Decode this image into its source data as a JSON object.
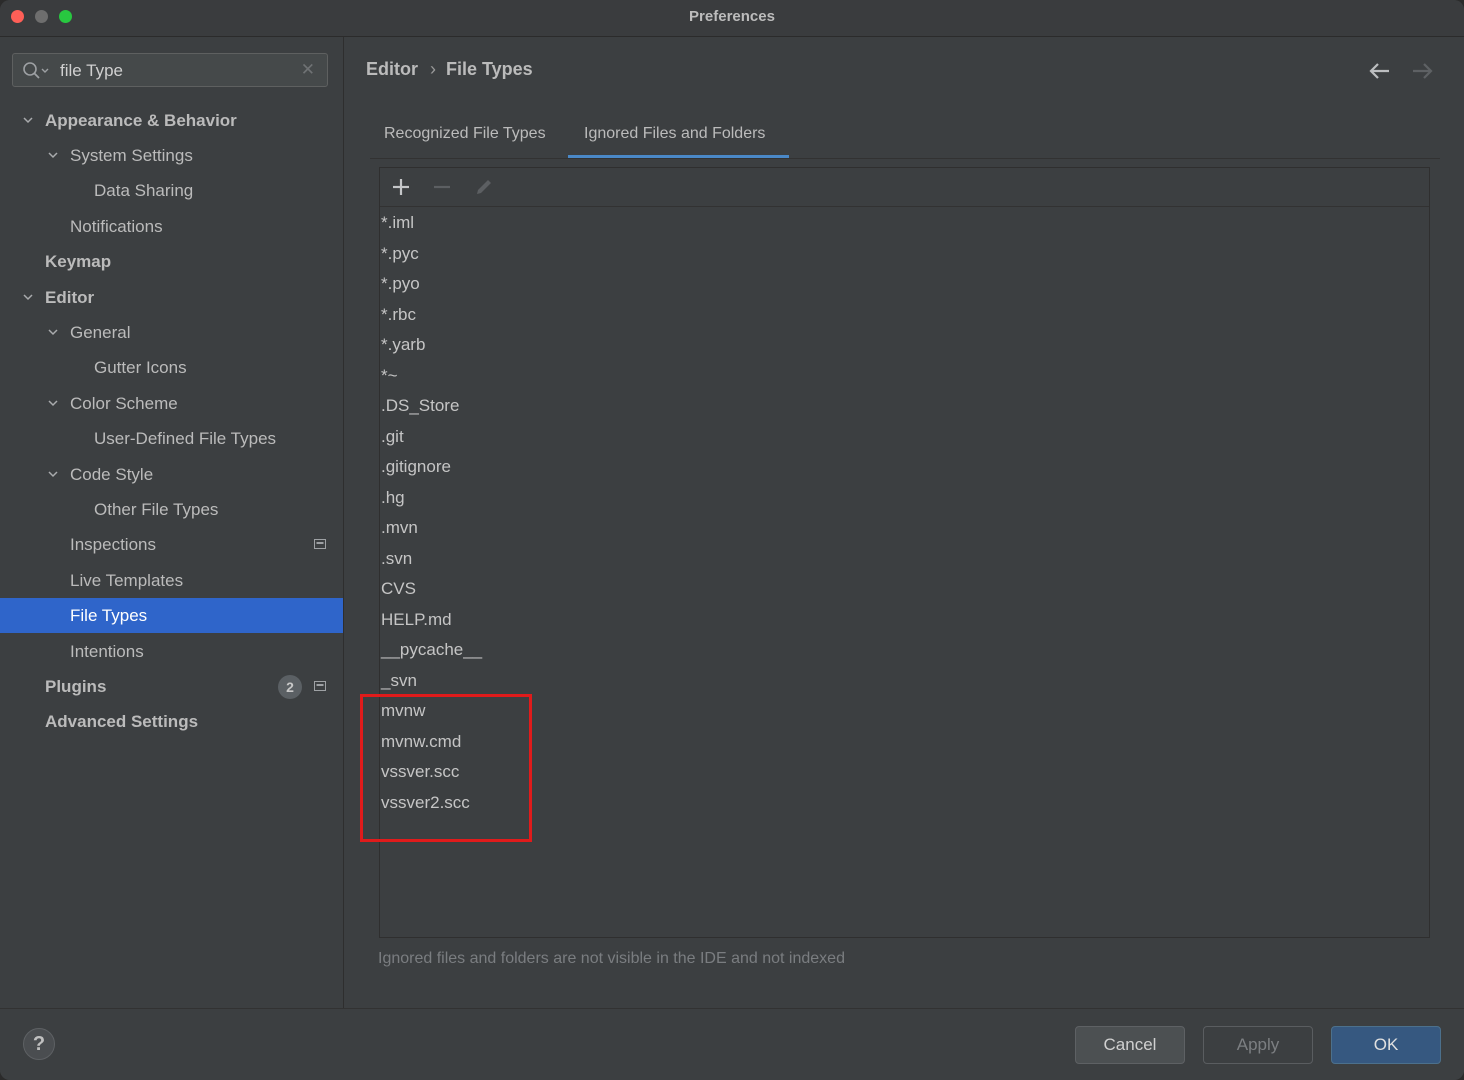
{
  "window": {
    "title": "Preferences"
  },
  "search": {
    "value": "file Type"
  },
  "sidebar": {
    "items": [
      {
        "label": "Appearance & Behavior"
      },
      {
        "label": "System Settings"
      },
      {
        "label": "Data Sharing"
      },
      {
        "label": "Notifications"
      },
      {
        "label": "Keymap"
      },
      {
        "label": "Editor"
      },
      {
        "label": "General"
      },
      {
        "label": "Gutter Icons"
      },
      {
        "label": "Color Scheme"
      },
      {
        "label": "User-Defined File Types"
      },
      {
        "label": "Code Style"
      },
      {
        "label": "Other File Types"
      },
      {
        "label": "Inspections"
      },
      {
        "label": "Live Templates"
      },
      {
        "label": "File Types"
      },
      {
        "label": "Intentions"
      },
      {
        "label": "Plugins",
        "badge": "2"
      },
      {
        "label": "Advanced Settings"
      }
    ]
  },
  "breadcrumb": {
    "parent": "Editor",
    "current": "File Types"
  },
  "tabs": [
    {
      "label": "Recognized File Types"
    },
    {
      "label": "Ignored Files and Folders"
    }
  ],
  "ignored_list": [
    "*.iml",
    "*.pyc",
    "*.pyo",
    "*.rbc",
    "*.yarb",
    "*~",
    ".DS_Store",
    ".git",
    ".gitignore",
    ".hg",
    ".mvn",
    ".svn",
    "CVS",
    "HELP.md",
    "__pycache__",
    "_svn",
    "mvnw",
    "mvnw.cmd",
    "vssver.scc",
    "vssver2.scc"
  ],
  "hint": "Ignored files and folders are not visible in the IDE and not indexed",
  "footer": {
    "cancel": "Cancel",
    "apply": "Apply",
    "ok": "OK",
    "help": "?"
  },
  "colors": {
    "selection": "#2f65ca",
    "tab_underline": "#4a88c7",
    "highlight_box": "#e01b1b"
  }
}
